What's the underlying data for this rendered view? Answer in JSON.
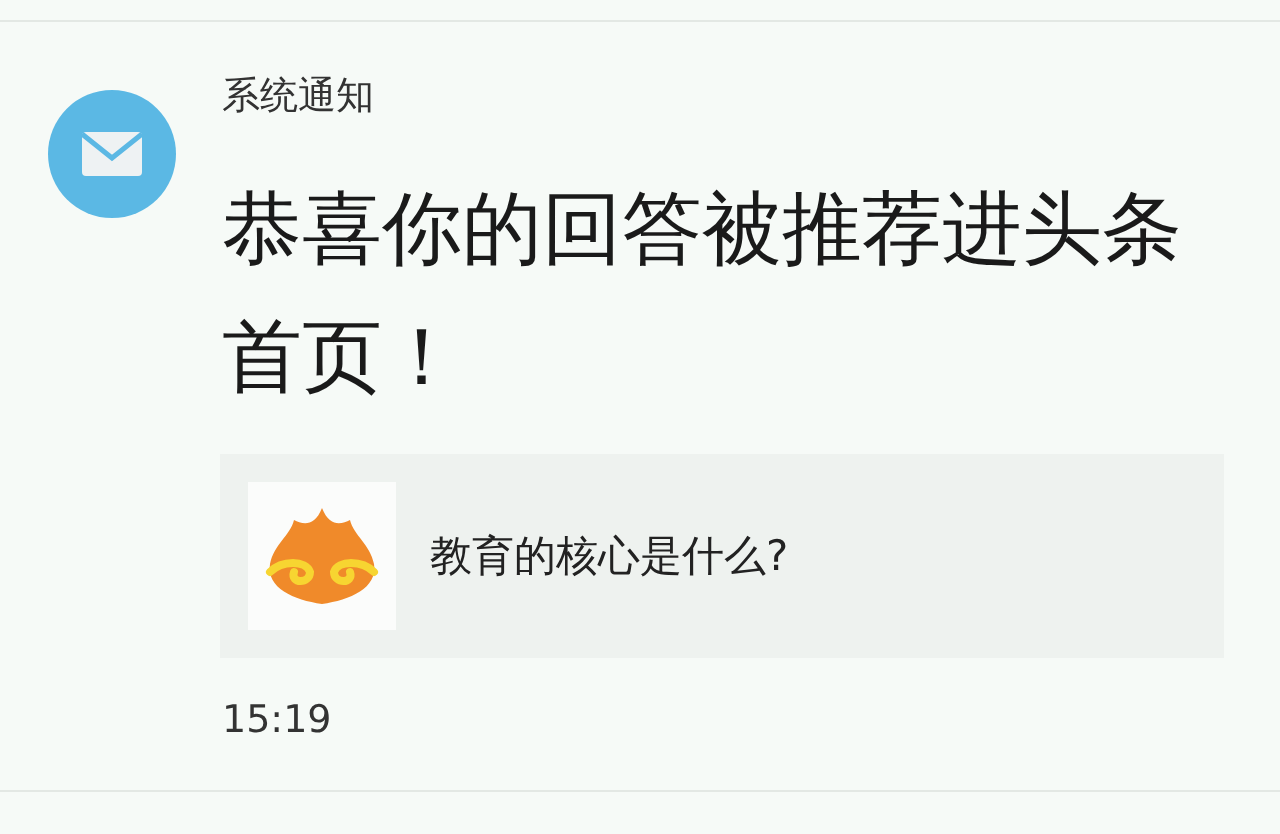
{
  "notification": {
    "sender": "系统通知",
    "title": "恭喜你的回答被推荐进头条首页！",
    "card": {
      "question": "教育的核心是什么?"
    },
    "time": "15:19"
  }
}
